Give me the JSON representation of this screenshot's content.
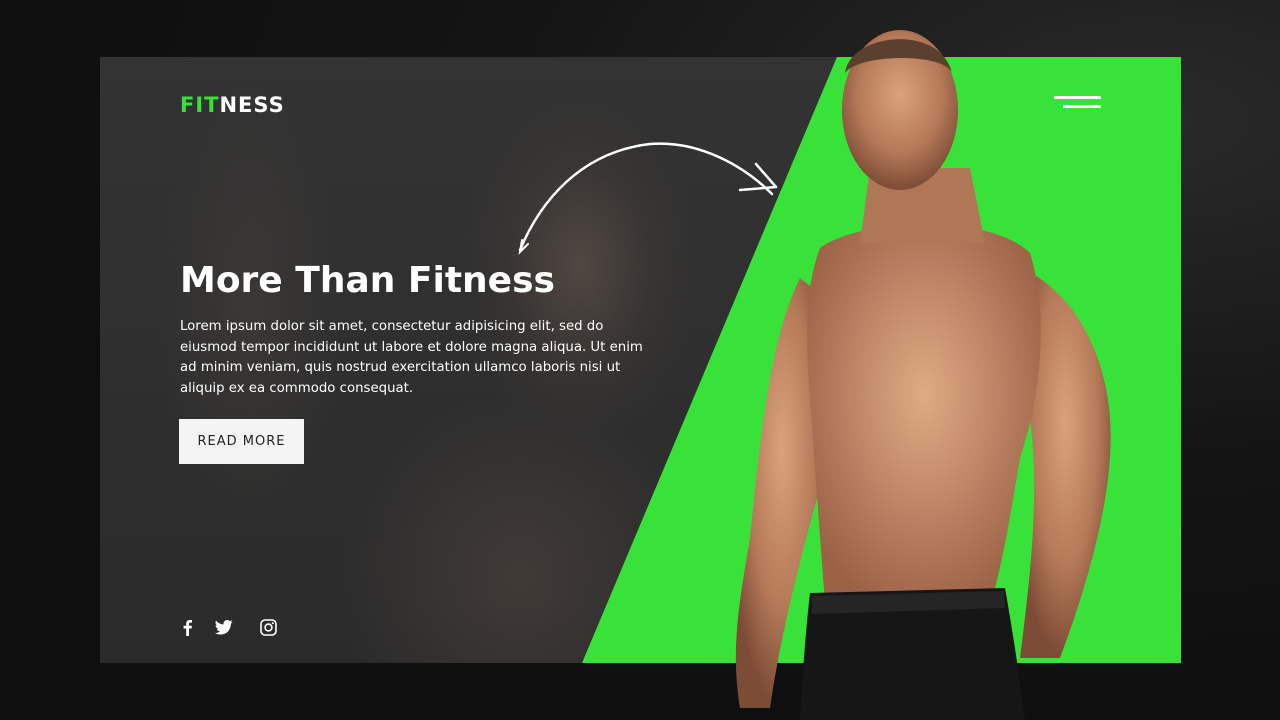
{
  "brand": {
    "logo_accent": "FIT",
    "logo_rest": "NESS",
    "accent_color": "#39e239"
  },
  "header": {
    "menu_icon": "hamburger-menu-icon"
  },
  "hero": {
    "title": "More Than Fitness",
    "body": "Lorem ipsum dolor sit amet, consectetur adipisicing elit, sed do eiusmod tempor incididunt ut labore et dolore magna aliqua. Ut enim ad minim veniam, quis nostrud exercitation ullamco laboris nisi ut aliquip ex ea commodo consequat.",
    "cta_label": "READ MORE"
  },
  "social": {
    "icons": [
      "facebook-icon",
      "twitter-icon",
      "instagram-icon"
    ]
  },
  "colors": {
    "page_bg": "#111111",
    "card_bg": "#2c2c2c",
    "green": "#39e239",
    "text": "#ffffff",
    "button_bg": "#f4f4f4"
  }
}
